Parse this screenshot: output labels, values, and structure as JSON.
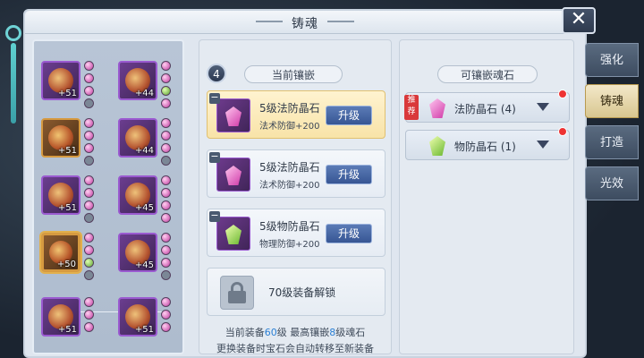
{
  "window": {
    "title": "铸魂",
    "close_label": "✕"
  },
  "side_tabs": [
    {
      "label": "强化",
      "active": false
    },
    {
      "label": "铸魂",
      "active": true
    },
    {
      "label": "打造",
      "active": false
    },
    {
      "label": "光效",
      "active": false
    }
  ],
  "equipment": [
    {
      "level": "+51",
      "gems": [
        "pink",
        "pink",
        "pink",
        "lock"
      ]
    },
    {
      "level": "+44",
      "gems": [
        "pink",
        "pink",
        "green",
        "pink"
      ]
    },
    {
      "level": "+51",
      "gems": [
        "pink",
        "pink",
        "pink",
        "lock"
      ]
    },
    {
      "level": "+44",
      "gems": [
        "pink",
        "pink",
        "pink",
        "lock"
      ]
    },
    {
      "level": "+51",
      "gems": [
        "pink",
        "pink",
        "pink",
        "lock"
      ]
    },
    {
      "level": "+45",
      "gems": [
        "pink",
        "pink",
        "pink",
        "pink"
      ]
    },
    {
      "level": "+50",
      "gems": [
        "pink",
        "pink",
        "green",
        "lock"
      ]
    },
    {
      "level": "+45",
      "gems": [
        "pink",
        "pink",
        "pink",
        "lock"
      ]
    },
    {
      "level": "+51",
      "gems": [
        "pink",
        "pink",
        "pink",
        "lock"
      ]
    },
    {
      "level": "+51",
      "gems": [
        "pink",
        "pink",
        "pink",
        "lock"
      ]
    }
  ],
  "inlay": {
    "header": "当前镶嵌",
    "count": "4",
    "slots": [
      {
        "name": "5级法防晶石",
        "attr": "法术防御+200",
        "button": "升级",
        "color": "pink",
        "active": true
      },
      {
        "name": "5级法防晶石",
        "attr": "法术防御+200",
        "button": "升级",
        "color": "pink",
        "active": false
      },
      {
        "name": "5级物防晶石",
        "attr": "物理防御+200",
        "button": "升级",
        "color": "green",
        "active": false
      }
    ],
    "locked_text": "70级装备解锁",
    "footnote_line1_prefix": "当前装备",
    "footnote_level": "60",
    "footnote_line1_mid": "级 最高镶嵌",
    "footnote_max": "8",
    "footnote_line1_suffix": "级魂石",
    "footnote_line2": "更换装备时宝石会自动转移至新装备"
  },
  "available": {
    "header": "可镶嵌魂石",
    "items": [
      {
        "label": "法防晶石 (4)",
        "tag": "推荐",
        "color": "pink"
      },
      {
        "label": "物防晶石 (1)",
        "tag": "",
        "color": "green"
      }
    ]
  }
}
